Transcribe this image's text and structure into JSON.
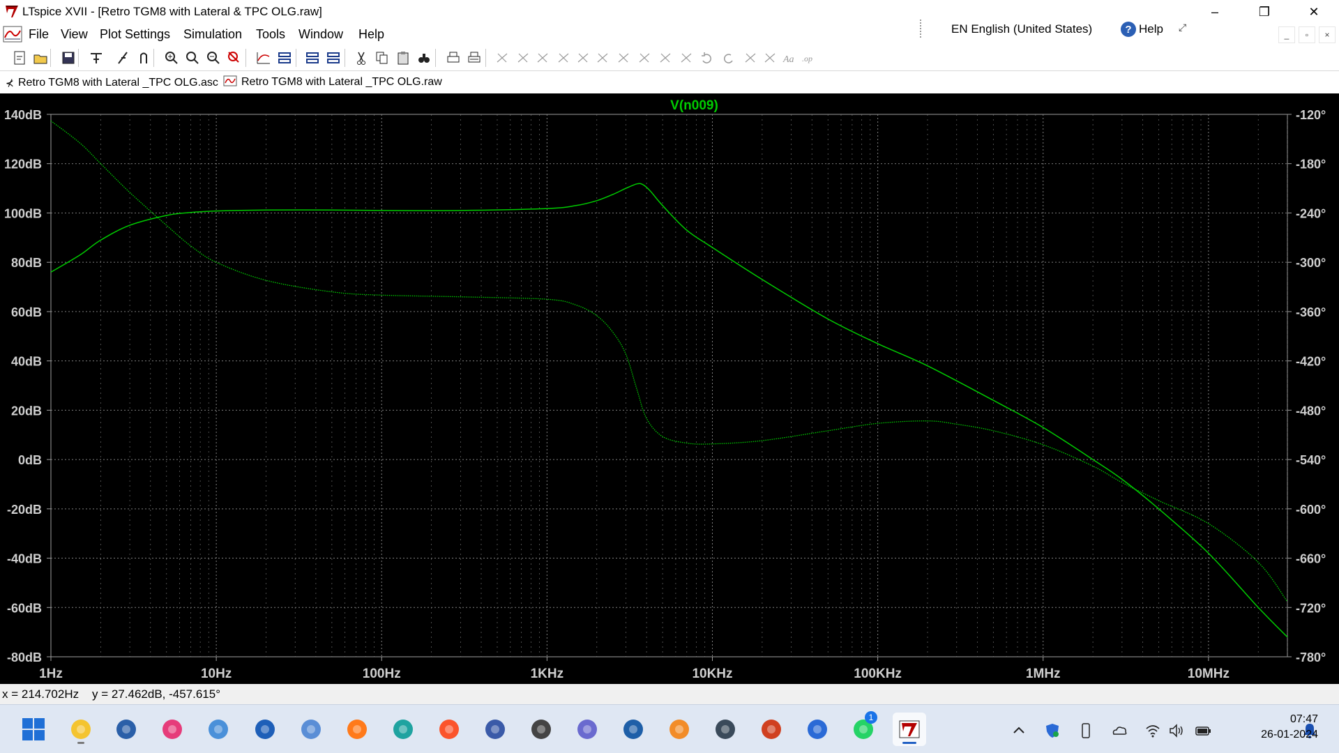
{
  "window": {
    "title": "LTspice XVII - [Retro TGM8 with Lateral & TPC OLG.raw]",
    "minimize_glyph": "–",
    "maximize_glyph": "❐",
    "close_glyph": "✕"
  },
  "language_bar": {
    "language": "EN English (United States)",
    "help_label": "Help",
    "help_glyph": "?"
  },
  "menu": {
    "items": [
      "File",
      "View",
      "Plot Settings",
      "Simulation",
      "Tools",
      "Window",
      "Help"
    ]
  },
  "mdi_controls": [
    "_",
    "▫",
    "×"
  ],
  "toolbar": {
    "buttons": [
      "new-schematic",
      "open",
      "save",
      "control-panel",
      "run",
      "halt",
      "zoom-in",
      "pan",
      "zoom-out",
      "zoom-full",
      "autorange",
      "tile-horizontal",
      "tile-vertical",
      "cascade",
      "cut",
      "copy",
      "paste",
      "find",
      "print",
      "print-preview",
      "draw-wire",
      "ground",
      "label-net",
      "resistor",
      "capacitor",
      "inductor",
      "diode",
      "component",
      "move",
      "drag",
      "undo",
      "redo",
      "rotate",
      "mirror",
      "text",
      "spice-directive"
    ]
  },
  "tabs": [
    {
      "label": "Retro TGM8 with Lateral _TPC OLG.asc",
      "active": false
    },
    {
      "label": "Retro TGM8 with Lateral _TPC OLG.raw",
      "active": true
    }
  ],
  "plot": {
    "background": "#000000",
    "grid_color": "#808080",
    "trace_color": "#00cc00"
  },
  "chart_data": {
    "type": "line",
    "title": "V(n009)",
    "xscale": "log",
    "xlim": [
      1,
      30000000
    ],
    "x_ticks": [
      "1Hz",
      "10Hz",
      "100Hz",
      "1KHz",
      "10KHz",
      "100KHz",
      "1MHz",
      "10MHz"
    ],
    "y_left_ticks": [
      "140dB",
      "120dB",
      "100dB",
      "80dB",
      "60dB",
      "40dB",
      "20dB",
      "0dB",
      "-20dB",
      "-40dB",
      "-60dB",
      "-80dB"
    ],
    "y_right_ticks": [
      "-120°",
      "-180°",
      "-240°",
      "-300°",
      "-360°",
      "-420°",
      "-480°",
      "-540°",
      "-600°",
      "-660°",
      "-720°",
      "-780°"
    ],
    "ylim_left": [
      -80,
      140
    ],
    "ylim_right": [
      -780,
      -120
    ],
    "series": [
      {
        "name": "V(n009)",
        "quantity": "magnitude (dB)",
        "style": "solid",
        "x": [
          1,
          1.5,
          2,
          3,
          5,
          7,
          10,
          20,
          50,
          100,
          300,
          1000,
          1500,
          2000,
          2500,
          3000,
          3500,
          3800,
          4200,
          5000,
          7000,
          10000,
          20000,
          50000,
          100000,
          200000,
          500000,
          1000000,
          2000000,
          3000000,
          5000000,
          10000000,
          20000000,
          30000000
        ],
        "y": [
          76,
          83,
          89,
          95,
          99,
          100.2,
          100.8,
          101.2,
          101.2,
          101,
          101,
          101.8,
          103,
          105,
          107.5,
          110,
          111.8,
          111.5,
          109,
          103,
          93,
          86,
          73,
          57,
          47,
          38,
          24,
          13,
          0,
          -8,
          -20,
          -38,
          -60,
          -72
        ]
      },
      {
        "name": "V(n009)",
        "quantity": "phase (°)",
        "style": "dotted",
        "x": [
          1,
          1.5,
          2,
          3,
          5,
          7,
          10,
          20,
          50,
          100,
          300,
          1000,
          1500,
          2000,
          2500,
          3000,
          3500,
          4000,
          5000,
          7000,
          10000,
          20000,
          50000,
          100000,
          200000,
          300000,
          500000,
          1000000,
          2000000,
          3000000,
          5000000,
          10000000,
          20000000,
          30000000
        ],
        "y": [
          -128,
          -155,
          -180,
          -215,
          -255,
          -280,
          -300,
          -322,
          -336,
          -340,
          -342,
          -345,
          -352,
          -365,
          -385,
          -412,
          -455,
          -490,
          -512,
          -520,
          -521,
          -517,
          -505,
          -496,
          -493,
          -497,
          -505,
          -522,
          -548,
          -568,
          -590,
          -618,
          -665,
          -713
        ]
      }
    ]
  },
  "status": {
    "readout": "x = 214.702Hz    y = 27.462dB, -457.615°"
  },
  "taskbar": {
    "apps": [
      "windows-start",
      "file-explorer",
      "microsoft-store",
      "itunes",
      "notepad",
      "mail",
      "photos",
      "firefox",
      "edge",
      "brave",
      "wireshark",
      "alien-app",
      "settings",
      "bing",
      "sublime",
      "steam",
      "winamp",
      "thunderbird",
      "whatsapp",
      "ltspice"
    ],
    "whatsapp_badge": "1",
    "clock_time": "07:47",
    "clock_date": "26-01-2024"
  }
}
